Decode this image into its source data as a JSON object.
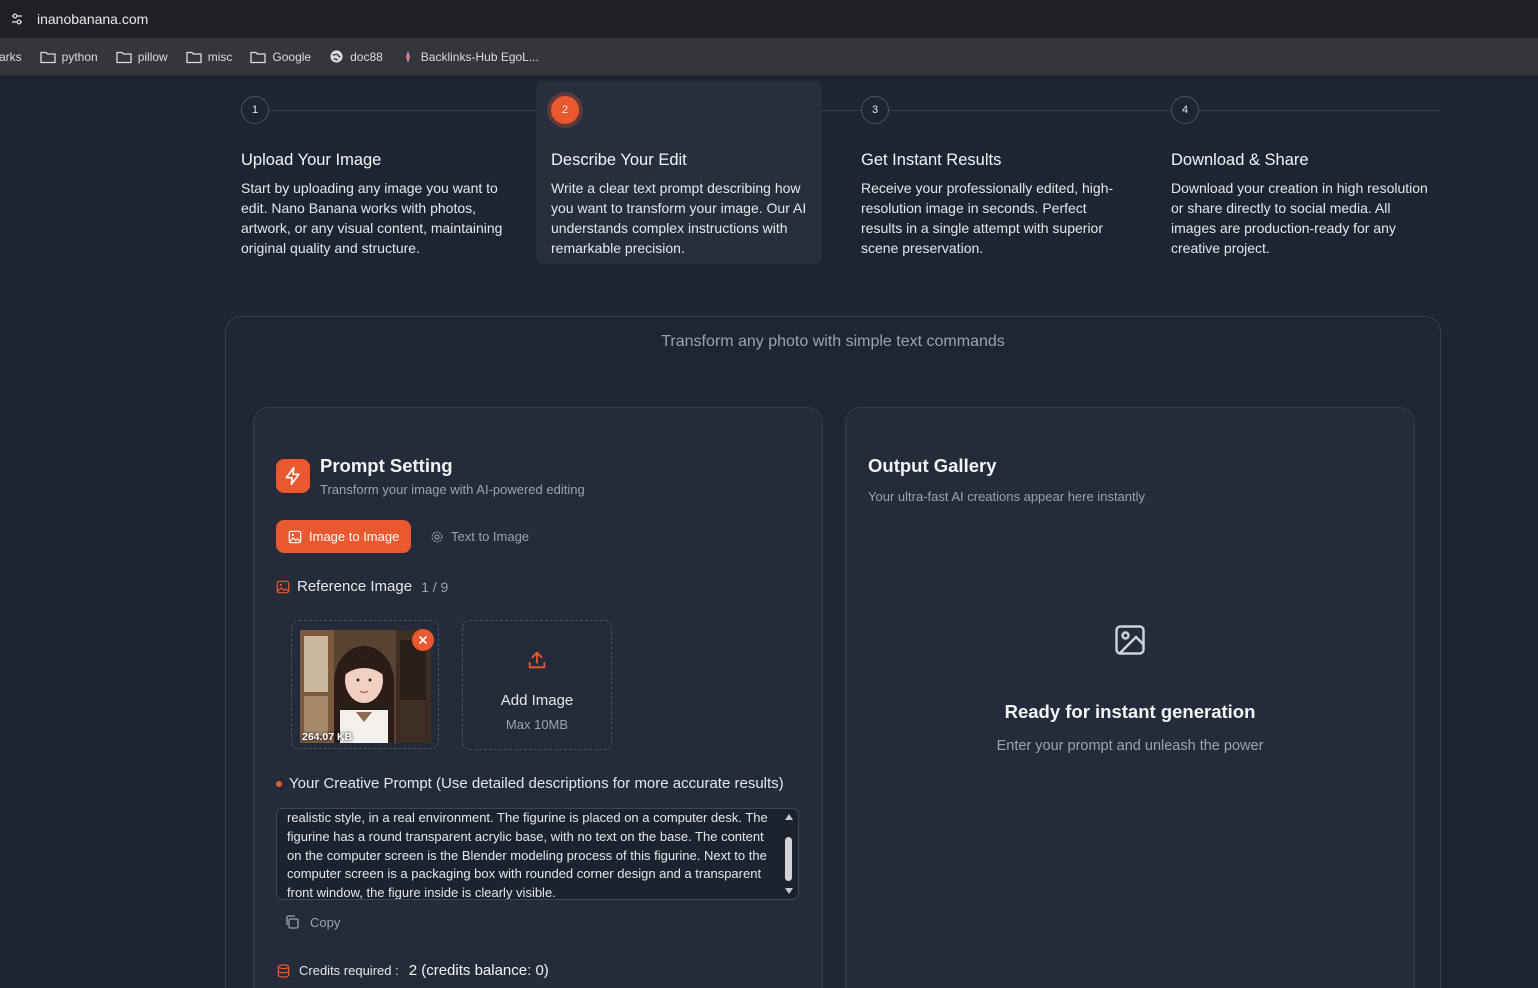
{
  "browser": {
    "url": "inanobanana.com",
    "bookmarks": [
      {
        "label": "arks",
        "icon": "none"
      },
      {
        "label": "python",
        "icon": "folder-icon"
      },
      {
        "label": "pillow",
        "icon": "folder-icon"
      },
      {
        "label": "misc",
        "icon": "folder-icon"
      },
      {
        "label": "Google",
        "icon": "folder-icon"
      },
      {
        "label": "doc88",
        "icon": "globe-icon"
      },
      {
        "label": "Backlinks-Hub EgoL...",
        "icon": "pen-icon"
      }
    ]
  },
  "steps": [
    {
      "num": "1",
      "title": "Upload Your Image",
      "desc": "Start by uploading any image you want to edit. Nano Banana works with photos, artwork, or any visual content, maintaining original quality and structure."
    },
    {
      "num": "2",
      "title": "Describe Your Edit",
      "desc": "Write a clear text prompt describing how you want to transform your image. Our AI understands complex instructions with remarkable precision.",
      "active": true
    },
    {
      "num": "3",
      "title": "Get Instant Results",
      "desc": "Receive your professionally edited, high-resolution image in seconds. Perfect results in a single attempt with superior scene preservation."
    },
    {
      "num": "4",
      "title": "Download & Share",
      "desc": "Download your creation in high resolution or share directly to social media. All images are production-ready for any creative project."
    }
  ],
  "tagline": "Transform any photo with simple text commands",
  "prompt_setting": {
    "title": "Prompt Setting",
    "subtitle": "Transform your image with AI-powered editing",
    "modes": {
      "image_to_image": "Image to Image",
      "text_to_image": "Text to Image",
      "active": "image_to_image"
    },
    "reference": {
      "label": "Reference Image",
      "count": "1 / 9"
    },
    "uploaded": {
      "size": "264.07 KB"
    },
    "add_image": {
      "label": "Add Image",
      "max": "Max 10MB"
    },
    "prompt_label": "Your Creative Prompt (Use detailed descriptions for more accurate results)",
    "prompt_value": "realistic style, in a real environment. The figurine is placed on a computer desk. The figurine has a round transparent acrylic base, with no text on the base. The content on the computer screen is the Blender modeling process of this figurine. Next to the computer screen is a packaging box with rounded corner design and a transparent front window, the figure inside is clearly visible.",
    "copy_label": "Copy",
    "credits_label": "Credits required :",
    "credits_value": "2 (credits balance: 0)"
  },
  "output_gallery": {
    "title": "Output Gallery",
    "subtitle": "Your ultra-fast AI creations appear here instantly",
    "empty_title": "Ready for instant generation",
    "empty_hint": "Enter your prompt and unleash the power"
  },
  "colors": {
    "accent": "#e9582e",
    "background": "#1e2433",
    "panel": "#252b3a"
  }
}
